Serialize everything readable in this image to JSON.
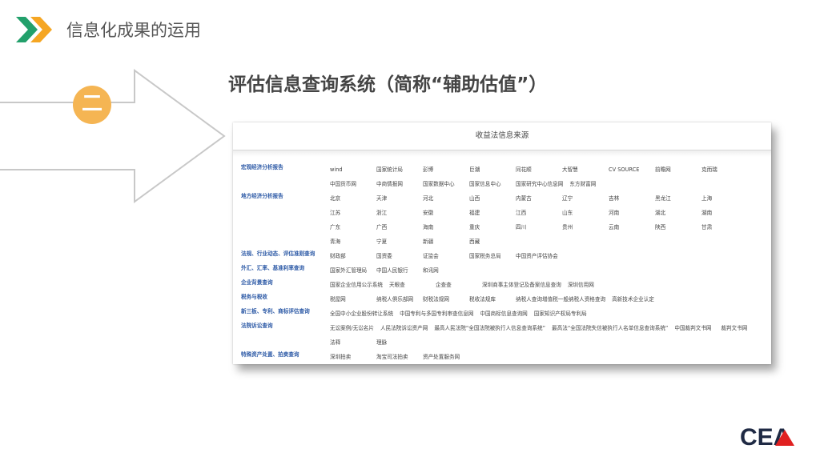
{
  "header": {
    "title": "信息化成果的运用"
  },
  "badge": {
    "text": "二"
  },
  "main": {
    "title": "评估信息查询系统（简称“辅助估值”）"
  },
  "panel": {
    "title": "收益法信息来源",
    "rows": [
      {
        "category": "宏观经济分析报告",
        "sources": [
          "wind",
          "国家统计局",
          "彭博",
          "巨潮",
          "同花顺",
          "大智慧",
          "CV SOURCE",
          "前瞻网",
          "克而瑞",
          "中国货币网",
          "中商情报网",
          "国家数据中心",
          "国家信息中心",
          "国家研究中心信息网",
          "东方财富网"
        ]
      },
      {
        "category": "地方经济分析报告",
        "sources": [
          "北京",
          "天津",
          "河北",
          "山西",
          "内蒙古",
          "辽宁",
          "吉林",
          "黑龙江",
          "上海",
          "江苏",
          "浙江",
          "安徽",
          "福建",
          "江西",
          "山东",
          "河南",
          "湖北",
          "湖南",
          "广东",
          "广西",
          "海南",
          "重庆",
          "四川",
          "贵州",
          "云南",
          "陕西",
          "甘肃",
          "青海",
          "宁夏",
          "新疆",
          "西藏"
        ]
      },
      {
        "category": "法规、行业动态、评估准则查询",
        "sources": [
          "财政部",
          "国资委",
          "证监会",
          "国家税务总局",
          "中国资产评估协会"
        ]
      },
      {
        "category": "外汇、汇率、基准利率查询",
        "sources": [
          "国家外汇管理局",
          "中国人民银行",
          "和讯网"
        ]
      },
      {
        "category": "企业背景查询",
        "sources": [
          "国家企业信用公示系统",
          "天眼查",
          "企查查",
          "深圳商事主体登记及备案信息查询",
          "深圳信用网"
        ]
      },
      {
        "category": "税务与税收",
        "sources": [
          "税屋网",
          "纳税人俱乐部网",
          "财税法规网",
          "税收法规库",
          "纳税人查询增值税一般纳税人资格查询",
          "高新技术企业认定"
        ]
      },
      {
        "category": "新三板、专利、商标评估查询",
        "sources": [
          "全国中小企业股份转让系统",
          "中国专利与多国专利审查信息网",
          "中国商标信息查询网",
          "国家知识产权局专利局"
        ]
      },
      {
        "category": "法院诉讼查询",
        "sources": [
          "无讼案例/无讼名片",
          "人民法院诉讼资产网",
          "最高人民法院“全国法院被执行人信息查询系统”",
          "最高法“全国法院失信被执行人名单信息查询系统”",
          "中国裁判文书网",
          "裁判文书网",
          "法释",
          "理脉"
        ]
      },
      {
        "category": "特殊资产处置、拍卖查询",
        "sources": [
          "深圳拍卖",
          "淘宝司法拍卖",
          "资产处置服务网"
        ]
      }
    ]
  },
  "logo": {
    "text": "CEA"
  },
  "colors": {
    "green": "#22a06b",
    "orange": "#f5a623",
    "badge": "#f5b553",
    "category_blue": "#2d5aa6"
  }
}
